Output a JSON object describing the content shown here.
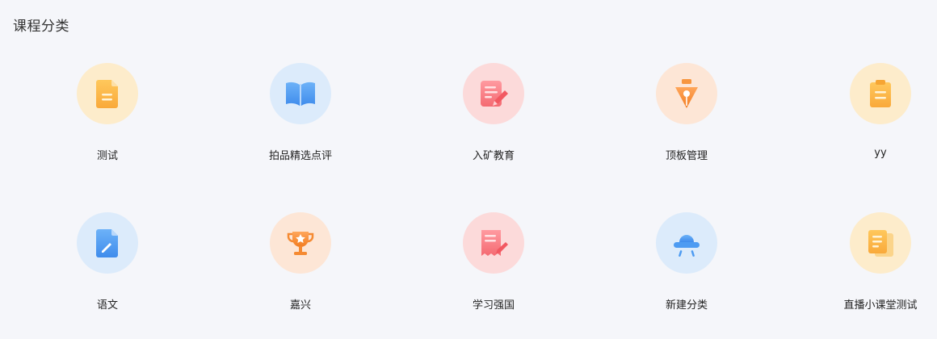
{
  "section": {
    "title": "课程分类"
  },
  "categories": [
    {
      "label": "测试",
      "icon": "document-icon",
      "bg_color": "#fdeccb",
      "icon_color": "#fbb54a"
    },
    {
      "label": "拍品精选点评",
      "icon": "open-book-icon",
      "bg_color": "#dcebfb",
      "icon_color": "#4d9bf2"
    },
    {
      "label": "入矿教育",
      "icon": "note-pencil-icon",
      "bg_color": "#fcdada",
      "icon_color": "#f6737a"
    },
    {
      "label": "顶板管理",
      "icon": "pen-nib-icon",
      "bg_color": "#fde6d6",
      "icon_color": "#f58a32"
    },
    {
      "label": "yy",
      "icon": "clipboard-icon",
      "bg_color": "#fdeccb",
      "icon_color": "#fbb54a"
    },
    {
      "label": "语文",
      "icon": "file-edit-icon",
      "bg_color": "#dcebfb",
      "icon_color": "#4d9bf2"
    },
    {
      "label": "嘉兴",
      "icon": "trophy-icon",
      "bg_color": "#fde6d6",
      "icon_color": "#f58a32"
    },
    {
      "label": "学习强国",
      "icon": "certificate-icon",
      "bg_color": "#fcdada",
      "icon_color": "#f6737a"
    },
    {
      "label": "新建分类",
      "icon": "ufo-lamp-icon",
      "bg_color": "#dcebfb",
      "icon_color": "#4d9bf2"
    },
    {
      "label": "直播小课堂测试",
      "icon": "stacked-pages-icon",
      "bg_color": "#fdeccb",
      "icon_color": "#fbb54a"
    }
  ]
}
